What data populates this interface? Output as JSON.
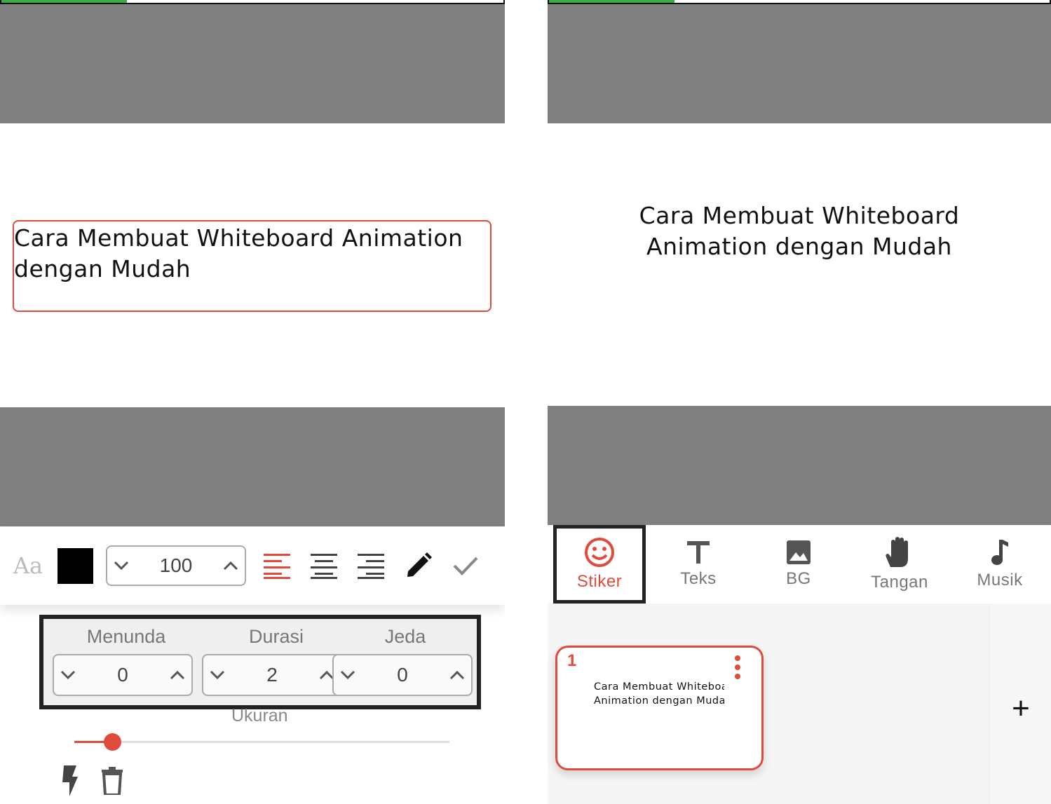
{
  "editor": {
    "progress_percent": 25,
    "canvas_text_line1": "Cara Membuat Whiteboard Animation",
    "canvas_text_line2": "dengan Mudah",
    "toolbar": {
      "font_button_label": "Aa",
      "text_color": "#000000",
      "size_value": "100"
    },
    "timing": {
      "delay_label": "Menunda",
      "delay_value": "0",
      "duration_label": "Durasi",
      "duration_value": "2",
      "pause_label": "Jeda",
      "pause_value": "0"
    },
    "size_label": "Ukuran",
    "size_slider_percent": 10
  },
  "preview": {
    "progress_percent": 25,
    "text_line1": "Cara Membuat Whiteboard",
    "text_line2": "Animation dengan Mudah",
    "tabs": [
      {
        "label": "Stiker",
        "icon": "smiley-icon",
        "active": true
      },
      {
        "label": "Teks",
        "icon": "text-t-icon",
        "active": false
      },
      {
        "label": "BG",
        "icon": "image-icon",
        "active": false
      },
      {
        "label": "Tangan",
        "icon": "hand-icon",
        "active": false
      },
      {
        "label": "Musik",
        "icon": "music-note-icon",
        "active": false
      }
    ],
    "scene": {
      "number": "1",
      "thumb_line1": "Cara Membuat Whiteboar",
      "thumb_line2": "Animation dengan Mudah"
    },
    "add_label": "+"
  },
  "colors": {
    "accent": "#e04b3c",
    "progress": "#3daa4a",
    "canvas_gray": "#808080"
  }
}
